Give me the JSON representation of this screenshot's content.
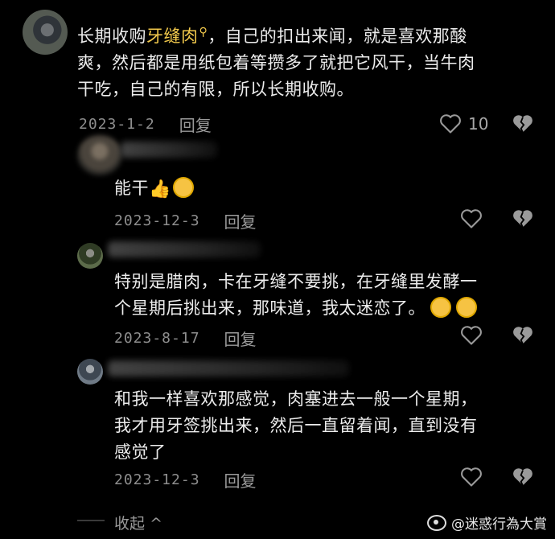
{
  "comment_main": {
    "text_before": "长期收购",
    "highlight": "牙缝肉",
    "search_mark": "⚲",
    "text_after_line1": "，自己的扣出来闻，就是喜欢那酸",
    "line2": "爽，然后都是用纸包着等攒多了就把它风干，当牛肉",
    "line3": "干吃，自己的有限，所以长期收购。",
    "date": "2023-1-2",
    "reply_label": "回复",
    "like_count": "10"
  },
  "reply1": {
    "text": "能干",
    "date": "2023-12-3",
    "reply_label": "回复"
  },
  "reply2": {
    "line1": "特别是腊肉，卡在牙缝不要挑，在牙缝里发酵一",
    "line2": "个星期后挑出来，那味道，我太迷恋了。",
    "date": "2023-8-17",
    "reply_label": "回复"
  },
  "reply3": {
    "line1": "和我一样喜欢那感觉，肉塞进去一般一个星期，",
    "line2": "我才用牙签挑出来，然后一直留着闻，直到没有",
    "line3": "感觉了",
    "date": "2023-12-3",
    "reply_label": "回复"
  },
  "collapse_label": "收起",
  "collapse_chevron": "^",
  "watermark": "@迷惑行為大賞",
  "icons": {
    "like": "heart-outline-icon",
    "dislike": "broken-heart-icon",
    "emoji_thumb": "thumbs-up-emoji",
    "emoji_laugh": "laughing-tears-emoji",
    "emoji_relieved": "relieved-face-emoji"
  }
}
